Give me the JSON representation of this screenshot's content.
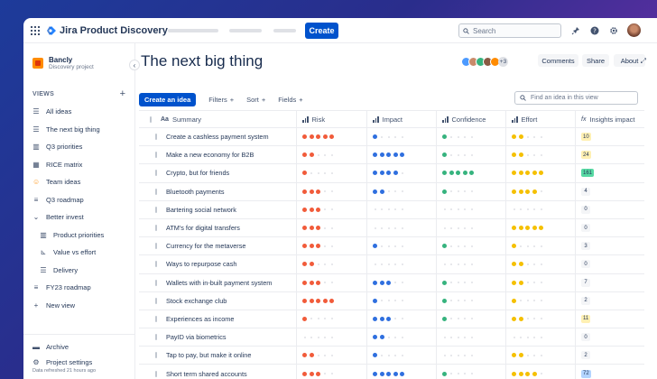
{
  "app": {
    "product_name": "Jira Product Discovery",
    "create_label": "Create",
    "search_placeholder": "Search"
  },
  "sidebar": {
    "project_name": "Bancly",
    "project_type": "Discovery project",
    "views_label": "VIEWS",
    "items": [
      {
        "label": "All ideas",
        "icon": "list-icon",
        "sub": false
      },
      {
        "label": "The next big thing",
        "icon": "list-icon",
        "sub": false
      },
      {
        "label": "Q3 priorities",
        "icon": "board-icon",
        "sub": false
      },
      {
        "label": "RICE matrix",
        "icon": "matrix-icon",
        "sub": false
      },
      {
        "label": "Team ideas",
        "icon": "smiley-icon",
        "sub": false
      },
      {
        "label": "Q3 roadmap",
        "icon": "roadmap-icon",
        "sub": false
      },
      {
        "label": "Better invest",
        "icon": "chevron-down-icon",
        "sub": false
      },
      {
        "label": "Product priorities",
        "icon": "board-icon",
        "sub": true
      },
      {
        "label": "Value vs effort",
        "icon": "chart-icon",
        "sub": true
      },
      {
        "label": "Delivery",
        "icon": "list-icon",
        "sub": true
      },
      {
        "label": "FY23 roadmap",
        "icon": "roadmap-icon",
        "sub": false
      },
      {
        "label": "New view",
        "icon": "plus-icon",
        "sub": false
      }
    ],
    "archive_label": "Archive",
    "settings_label": "Project settings",
    "refresh_text": "Data refreshed 21 hours ago"
  },
  "main": {
    "title": "The next big thing",
    "avatar_overflow": "+3",
    "comments_label": "Comments",
    "share_label": "Share",
    "about_label": "About",
    "create_idea_label": "Create an idea",
    "filters_label": "Filters",
    "sort_label": "Sort",
    "fields_label": "Fields",
    "find_placeholder": "Find an idea in this view"
  },
  "table": {
    "headers": {
      "summary": "Summary",
      "risk": "Risk",
      "impact": "Impact",
      "confidence": "Confidence",
      "effort": "Effort",
      "insights": "Insights impact"
    },
    "colors": {
      "risk": "#f15b3a",
      "impact": "#2f6fdf",
      "confidence": "#36b37e",
      "effort": "#f5c000",
      "empty": "#dfe1e6"
    },
    "rows": [
      {
        "summary": "Create a cashless payment system",
        "risk": 5,
        "impact": 1,
        "confidence": 1,
        "effort": 2,
        "insights": "10",
        "insights_color": "#fff0b3"
      },
      {
        "summary": "Make a new economy for B2B",
        "risk": 2,
        "impact": 5,
        "confidence": 1,
        "effort": 2,
        "insights": "24",
        "insights_color": "#fff0b3"
      },
      {
        "summary": "Crypto, but for friends",
        "risk": 1,
        "impact": 4,
        "confidence": 5,
        "effort": 5,
        "insights": "161",
        "insights_color": "#57d9a3"
      },
      {
        "summary": "Bluetooth payments",
        "risk": 3,
        "impact": 2,
        "confidence": 1,
        "effort": 4,
        "insights": "4",
        "insights_color": "#f4f5f7"
      },
      {
        "summary": "Bartering social network",
        "risk": 3,
        "impact": 0,
        "confidence": 0,
        "effort": 0,
        "insights": "0",
        "insights_color": "#f4f5f7"
      },
      {
        "summary": "ATM's for digital transfers",
        "risk": 3,
        "impact": 0,
        "confidence": 0,
        "effort": 5,
        "insights": "0",
        "insights_color": "#f4f5f7"
      },
      {
        "summary": "Currency for the metaverse",
        "risk": 3,
        "impact": 1,
        "confidence": 1,
        "effort": 1,
        "insights": "3",
        "insights_color": "#f4f5f7"
      },
      {
        "summary": "Ways to repurpose cash",
        "risk": 2,
        "impact": 0,
        "confidence": 0,
        "effort": 2,
        "insights": "0",
        "insights_color": "#f4f5f7"
      },
      {
        "summary": "Wallets with in-built payment system",
        "risk": 3,
        "impact": 3,
        "confidence": 1,
        "effort": 2,
        "insights": "7",
        "insights_color": "#f4f5f7"
      },
      {
        "summary": "Stock exchange club",
        "risk": 5,
        "impact": 1,
        "confidence": 1,
        "effort": 1,
        "insights": "2",
        "insights_color": "#f4f5f7"
      },
      {
        "summary": "Experiences as income",
        "risk": 1,
        "impact": 3,
        "confidence": 1,
        "effort": 2,
        "insights": "11",
        "insights_color": "#fff0b3"
      },
      {
        "summary": "PayID via biometrics",
        "risk": 0,
        "impact": 2,
        "confidence": 0,
        "effort": 0,
        "insights": "0",
        "insights_color": "#f4f5f7"
      },
      {
        "summary": "Tap to pay, but make it online",
        "risk": 2,
        "impact": 1,
        "confidence": 0,
        "effort": 2,
        "insights": "2",
        "insights_color": "#f4f5f7"
      },
      {
        "summary": "Short term shared accounts",
        "risk": 3,
        "impact": 5,
        "confidence": 1,
        "effort": 4,
        "insights": "72",
        "insights_color": "#b3d4ff"
      }
    ]
  }
}
